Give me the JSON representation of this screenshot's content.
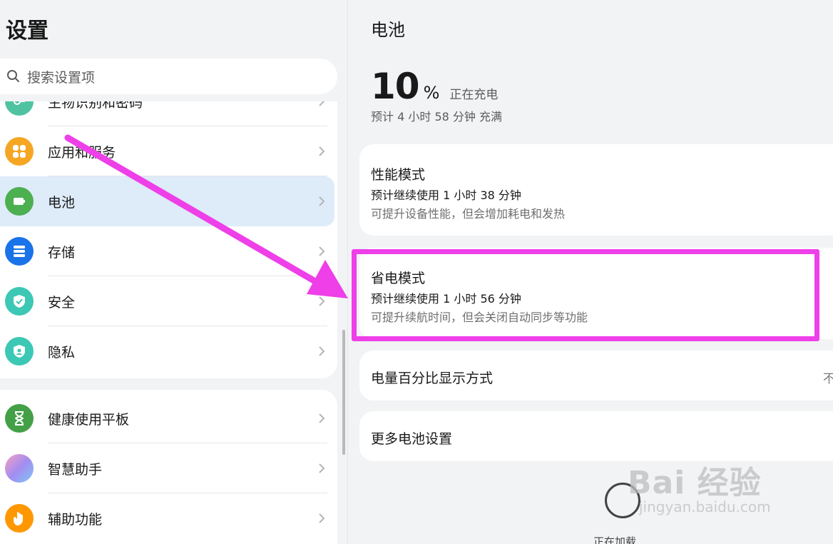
{
  "left": {
    "title": "设置",
    "search_placeholder": "搜索设置项",
    "group1": [
      {
        "label": "生物识别和密码",
        "icon": "key-icon",
        "color": "#4fc3a1"
      },
      {
        "label": "应用和服务",
        "icon": "apps-icon",
        "color": "#f5a623"
      },
      {
        "label": "电池",
        "icon": "battery-icon",
        "color": "#4caf50"
      },
      {
        "label": "存储",
        "icon": "storage-icon",
        "color": "#1a73e8"
      },
      {
        "label": "安全",
        "icon": "shield-check-icon",
        "color": "#3cc8b4"
      },
      {
        "label": "隐私",
        "icon": "privacy-shield-icon",
        "color": "#3cc8b4"
      }
    ],
    "group2": [
      {
        "label": "健康使用平板",
        "icon": "hourglass-icon",
        "color": "#43a047"
      },
      {
        "label": "智慧助手",
        "icon": "assistant-icon",
        "color": "#c18ce8"
      },
      {
        "label": "辅助功能",
        "icon": "hand-icon",
        "color": "#ff9800"
      }
    ]
  },
  "right": {
    "title": "电池",
    "percent": "10",
    "percent_sign": "%",
    "charging_status": "正在充电",
    "estimate": "预计 4 小时 58 分钟 充满",
    "performance": {
      "title": "性能模式",
      "sub1": "预计继续使用 1 小时 38 分钟",
      "sub2": "可提升设备性能，但会增加耗电和发热"
    },
    "power_saving": {
      "title": "省电模式",
      "sub1": "预计继续使用 1 小时 56 分钟",
      "sub2": "可提升续航时间，但会关闭自动同步等功能"
    },
    "percent_display": {
      "title": "电量百分比显示方式",
      "value": "不"
    },
    "more": {
      "title": "更多电池设置"
    },
    "loading": "正在加载"
  },
  "watermark": {
    "main": "Bai 经验",
    "sub": "jingyan.baidu.com"
  },
  "colors": {
    "annotation": "#ee3fe8",
    "active_bg": "#deebf9"
  }
}
